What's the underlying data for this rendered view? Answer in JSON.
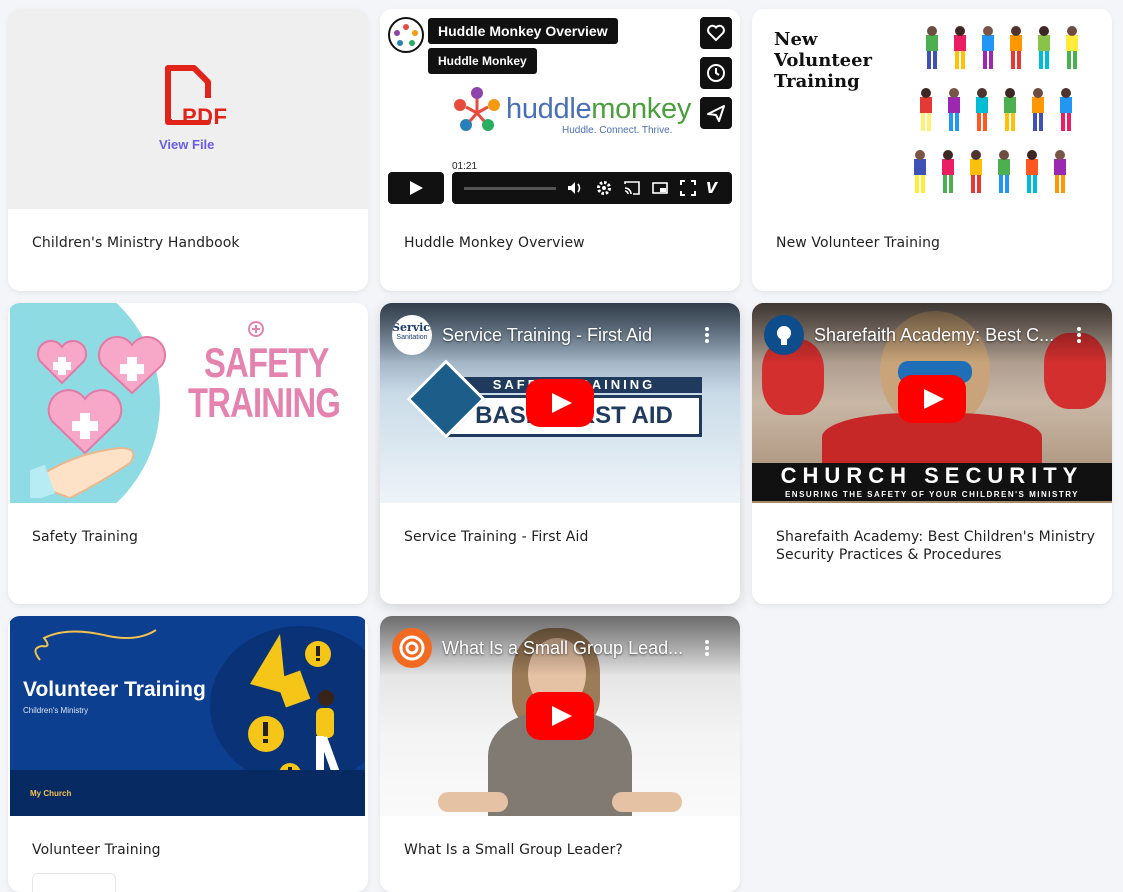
{
  "cards": [
    {
      "title": "Children's Ministry Handbook",
      "thumb": {
        "type": "pdf",
        "badge": "PDF",
        "link": "View File"
      }
    },
    {
      "title": "Huddle Monkey Overview",
      "thumb": {
        "type": "vimeo",
        "video_title": "Huddle Monkey Overview",
        "channel": "Huddle Monkey",
        "brand": "huddlemonkey",
        "brand_part1": "huddle",
        "brand_part2": "monkey",
        "tagline": "Huddle. Connect. Thrive.",
        "time": "01:21"
      }
    },
    {
      "title": "New Volunteer Training",
      "thumb": {
        "type": "image",
        "heading": "New Volunteer Training"
      }
    },
    {
      "title": "Safety Training",
      "thumb": {
        "type": "image",
        "heading_line1": "SAFETY",
        "heading_line2": "TRAINING"
      }
    },
    {
      "title": "Service Training - First Aid",
      "thumb": {
        "type": "youtube",
        "video_title": "Service Training - First Aid",
        "logo_line1": "Service",
        "logo_line2": "Sanitation",
        "banner_top": "SAFETY TRAINING",
        "banner_main": "BASIC FIRST AID"
      }
    },
    {
      "title": "Sharefaith Academy: Best Children's Ministry Security Practices & Procedures",
      "thumb": {
        "type": "youtube",
        "video_title": "Sharefaith Academy: Best C...",
        "banner": "CHURCH SECURITY",
        "subbanner": "ENSURING THE SAFETY OF YOUR CHILDREN'S MINISTRY"
      }
    },
    {
      "title": "Volunteer Training",
      "thumb": {
        "type": "image",
        "heading": "Volunteer Training",
        "subheading": "Children's Ministry",
        "footer": "My Church"
      }
    },
    {
      "title": "What Is a Small Group Leader?",
      "thumb": {
        "type": "youtube",
        "video_title": "What Is a Small Group Lead..."
      }
    }
  ],
  "colors": {
    "page_bg": "#f3f5f9",
    "pdf_red": "#e2231a",
    "link_purple": "#6b5ce7",
    "youtube_red": "#ff0000",
    "safety_pink": "#e483b0",
    "vol_blue": "#0c3f8f"
  }
}
